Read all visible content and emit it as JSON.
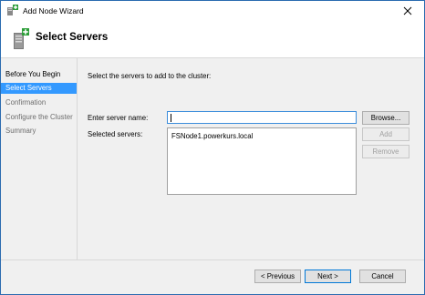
{
  "window": {
    "title": "Add Node Wizard",
    "close_glyph": "✕"
  },
  "header": {
    "heading": "Select Servers",
    "icon": "server-add-icon"
  },
  "nav": {
    "items": [
      {
        "label": "Before You Begin",
        "state": "normal"
      },
      {
        "label": "Select Servers",
        "state": "active"
      },
      {
        "label": "Confirmation",
        "state": "dim"
      },
      {
        "label": "Configure the Cluster",
        "state": "dim"
      },
      {
        "label": "Summary",
        "state": "dim"
      }
    ]
  },
  "main": {
    "instruction": "Select the servers to add to the cluster:",
    "server_name_label": "Enter server name:",
    "server_name_value": "",
    "selected_label": "Selected servers:",
    "selected_servers": [
      "FSNode1.powerkurs.local"
    ],
    "browse_label": "Browse...",
    "add_label": "Add",
    "remove_label": "Remove"
  },
  "footer": {
    "previous_label": "< Previous",
    "next_label": "Next >",
    "cancel_label": "Cancel"
  },
  "colors": {
    "accent": "#3399ff",
    "focus_border": "#0078d7"
  }
}
